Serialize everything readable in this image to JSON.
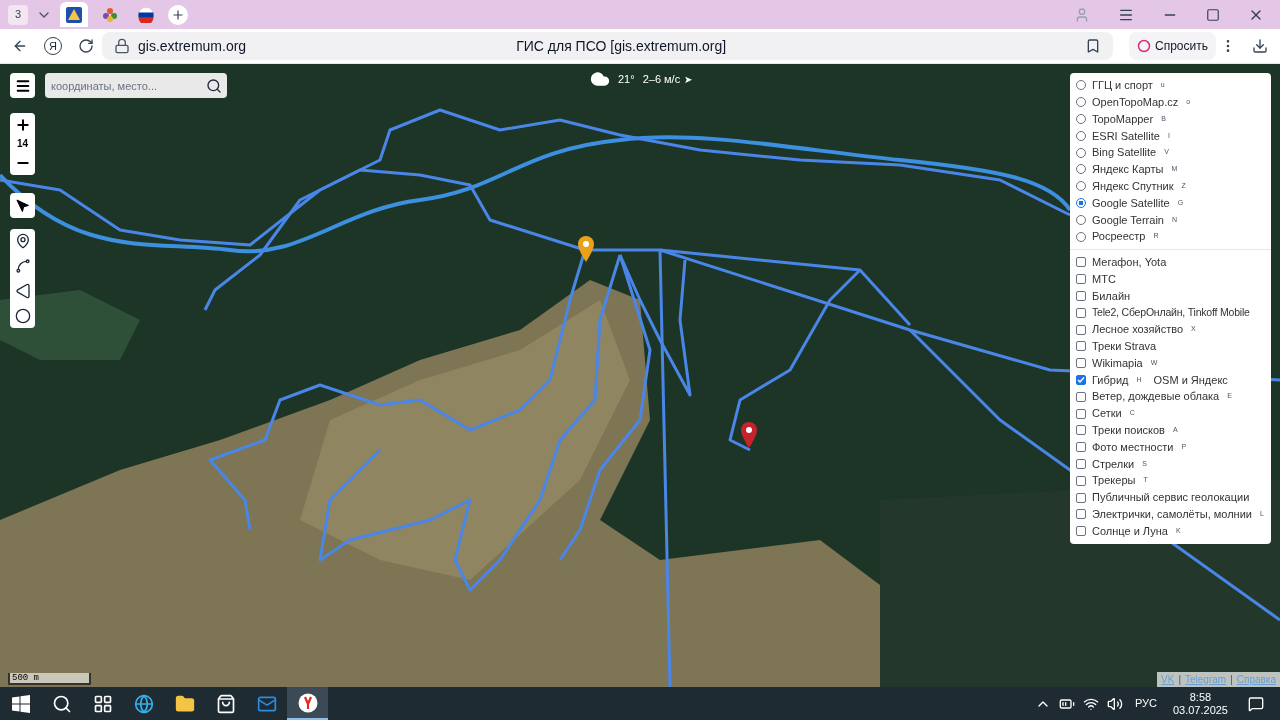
{
  "browser": {
    "tab_count": "3",
    "tabs": [
      {
        "kind": "gis",
        "selected": true
      },
      {
        "kind": "flower",
        "selected": false
      },
      {
        "kind": "flag",
        "selected": false
      }
    ],
    "url": "gis.extremum.org",
    "page_title": "ГИС для ПСО [gis.extremum.org]",
    "ask_button": "Спросить",
    "yandex_button": "Я"
  },
  "map": {
    "search": {
      "placeholder": "координаты, место..."
    },
    "weather": {
      "temperature": "21°",
      "wind": "2–6 м/с",
      "wind_arrow": "➤"
    },
    "zoom": "14",
    "scale": "500 m",
    "footer_links": [
      "VK",
      "Telegram",
      "Справка"
    ],
    "footer_separators": [
      "|",
      "|"
    ]
  },
  "layers": {
    "base": [
      {
        "name": "ГГЦ и спорт",
        "key": "u",
        "selected": false
      },
      {
        "name": "OpenTopoMap.cz",
        "key": "o",
        "selected": false
      },
      {
        "name": "TopoMapper",
        "key": "B",
        "selected": false
      },
      {
        "name": "ESRI Satellite",
        "key": "I",
        "selected": false
      },
      {
        "name": "Bing Satellite",
        "key": "V",
        "selected": false
      },
      {
        "name": "Яндекс Карты",
        "key": "M",
        "selected": false
      },
      {
        "name": "Яндекс Спутник",
        "key": "Z",
        "selected": false
      },
      {
        "name": "Google Satellite",
        "key": "G",
        "selected": true
      },
      {
        "name": "Google Terrain",
        "key": "N",
        "selected": false
      },
      {
        "name": "Росреестр",
        "key": "R",
        "selected": false
      }
    ],
    "overlays": [
      {
        "name": "Мегафон, Yota",
        "checked": false
      },
      {
        "name": "МТС",
        "checked": false
      },
      {
        "name": "Билайн",
        "checked": false
      },
      {
        "name": "Tele2, СберОнлайн, Tinkoff Mobile",
        "checked": false
      },
      {
        "name": "Лесное хозяйство",
        "key": "X",
        "checked": false
      },
      {
        "name": "Треки Strava",
        "checked": false
      },
      {
        "name": "Wikimapia",
        "key": "W",
        "checked": false
      },
      {
        "name": "Гибрид",
        "key": "H",
        "note": "OSM и Яндекс",
        "checked": true
      },
      {
        "name": "Ветер, дождевые облака",
        "key": "E",
        "checked": false
      },
      {
        "name": "Сетки",
        "key": "C",
        "checked": false
      },
      {
        "name": "Треки поисков",
        "key": "A",
        "checked": false
      },
      {
        "name": "Фото местности",
        "key": "P",
        "checked": false
      },
      {
        "name": "Стрелки",
        "key": "S",
        "checked": false
      },
      {
        "name": "Трекеры",
        "key": "T",
        "checked": false
      },
      {
        "name": "Публичный сервис геолокации",
        "checked": false
      },
      {
        "name": "Электрички, самолёты, молнии",
        "key": "L",
        "checked": false
      },
      {
        "name": "Солнце и Луна",
        "key": "K",
        "checked": false
      }
    ]
  },
  "taskbar": {
    "apps": [
      {
        "kind": "start",
        "selected": false
      },
      {
        "kind": "search",
        "selected": false
      },
      {
        "kind": "taskview",
        "selected": false
      },
      {
        "kind": "edge",
        "selected": false
      },
      {
        "kind": "explorer",
        "selected": false
      },
      {
        "kind": "store",
        "selected": false
      },
      {
        "kind": "mail",
        "selected": false
      },
      {
        "kind": "yandex",
        "selected": true
      }
    ],
    "language": "РУС",
    "time": "8:58",
    "date": "03.07.2025"
  }
}
